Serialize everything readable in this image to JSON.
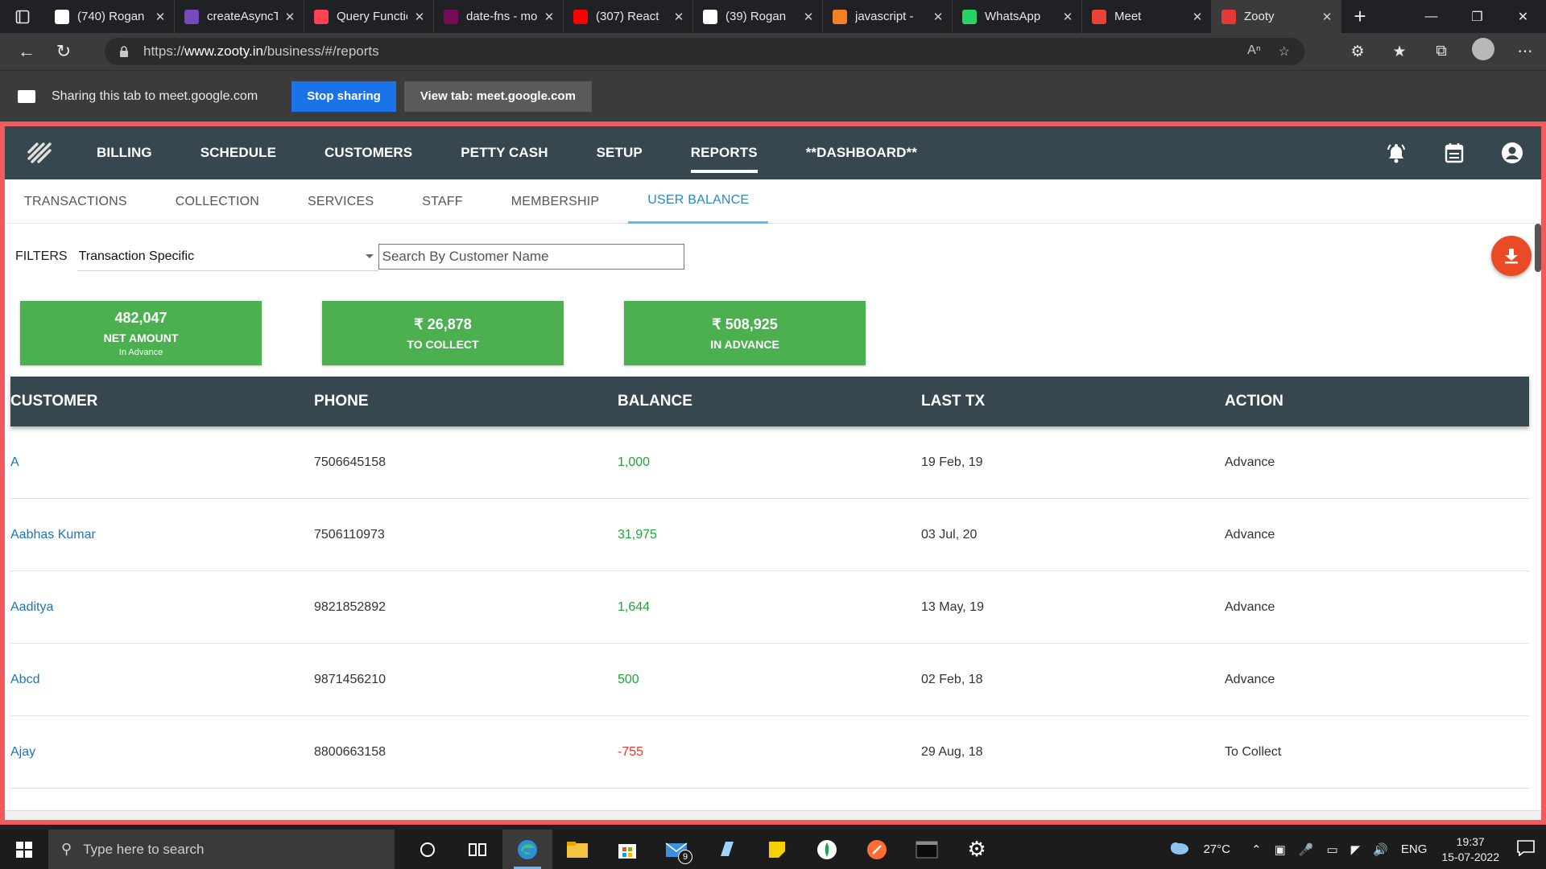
{
  "browser": {
    "tabs": [
      {
        "label": "(740) Rogan",
        "color": "#ffffff"
      },
      {
        "label": "createAsyncThunk",
        "color": "#764abc"
      },
      {
        "label": "Query Functions",
        "color": "#ff4154"
      },
      {
        "label": "date-fns - modern",
        "color": "#770c56"
      },
      {
        "label": "(307) React",
        "color": "#ff0000"
      },
      {
        "label": "(39) Rogan",
        "color": "#ffffff"
      },
      {
        "label": "javascript - ",
        "color": "#f48024"
      },
      {
        "label": "WhatsApp",
        "color": "#25d366"
      },
      {
        "label": "Meet",
        "color": "#ea4335"
      },
      {
        "label": "Zooty",
        "color": "#e53935"
      }
    ],
    "url_scheme": "https://",
    "url_host": "www.zooty.in",
    "url_path": "/business/#/reports"
  },
  "sharebar": {
    "text": "Sharing this tab to meet.google.com",
    "stop_label": "Stop sharing",
    "view_label": "View tab: meet.google.com"
  },
  "nav": {
    "items": [
      "BILLING",
      "SCHEDULE",
      "CUSTOMERS",
      "PETTY CASH",
      "SETUP",
      "REPORTS",
      "**DASHBOARD**"
    ],
    "active": "REPORTS"
  },
  "subtabs": {
    "items": [
      "TRANSACTIONS",
      "COLLECTION",
      "SERVICES",
      "STAFF",
      "MEMBERSHIP",
      "USER BALANCE"
    ],
    "active": "USER BALANCE"
  },
  "filters": {
    "label": "FILTERS",
    "select_value": "Transaction Specific",
    "search_placeholder": "Search By Customer Name"
  },
  "cards": [
    {
      "value": "482,047",
      "label": "NET AMOUNT",
      "sub": "In Advance"
    },
    {
      "value": "₹ 26,878",
      "label": "TO COLLECT",
      "sub": ""
    },
    {
      "value": "₹ 508,925",
      "label": "IN ADVANCE",
      "sub": ""
    }
  ],
  "table": {
    "headers": [
      "CUSTOMER",
      "PHONE",
      "BALANCE",
      "LAST TX",
      "ACTION"
    ],
    "rows": [
      {
        "customer": "A",
        "phone": "7506645158",
        "balance": "1,000",
        "last_tx": "19 Feb, 19",
        "action": "Advance"
      },
      {
        "customer": "Aabhas Kumar",
        "phone": "7506110973",
        "balance": "31,975",
        "last_tx": "03 Jul, 20",
        "action": "Advance"
      },
      {
        "customer": "Aaditya",
        "phone": "9821852892",
        "balance": "1,644",
        "last_tx": "13 May, 19",
        "action": "Advance"
      },
      {
        "customer": "Abcd",
        "phone": "9871456210",
        "balance": "500",
        "last_tx": "02 Feb, 18",
        "action": "Advance"
      },
      {
        "customer": "Ajay",
        "phone": "8800663158",
        "balance": "-755",
        "last_tx": "29 Aug, 18",
        "action": "To Collect"
      }
    ]
  },
  "taskbar": {
    "search_placeholder": "Type here to search",
    "mail_badge": "9",
    "weather": "27°C",
    "lang": "ENG",
    "time": "19:37",
    "date": "15-07-2022"
  },
  "colors": {
    "navbar": "#37474f",
    "card_green": "#4caf50",
    "active_tab": "#2a88c2",
    "positive": "#22a33a",
    "negative": "#e53935",
    "page_border": "#f15a5f",
    "download_button": "#ea4b26"
  }
}
